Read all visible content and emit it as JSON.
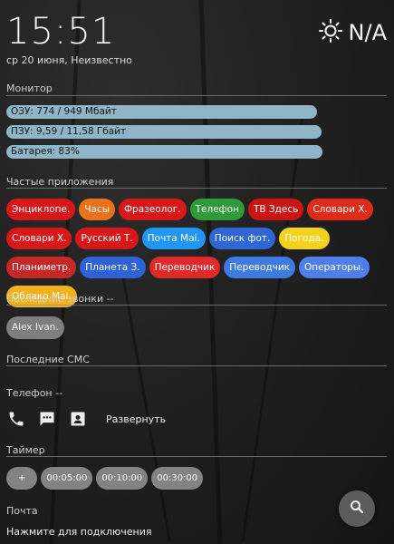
{
  "clock": {
    "time": "15:51",
    "date": "ср 20 июня, Неизвестно"
  },
  "weather": {
    "icon": "sun-icon",
    "value": "N/A"
  },
  "monitor": {
    "title": "Монитор",
    "ram": {
      "label": "ОЗУ: 774 / 949 Мбайт",
      "fill": 0.82
    },
    "storage": {
      "label": "ПЗУ: 9,59 / 11,58 Гбайт",
      "fill": 0.83
    },
    "battery": {
      "label": "Батарея: 83%",
      "fill": 0.83
    },
    "bar_color": "#8fb6c8"
  },
  "apps": {
    "title": "Частые приложения",
    "items": [
      {
        "label": "Энциклопе.",
        "color": "#d81818"
      },
      {
        "label": "Часы",
        "color": "#e8711a"
      },
      {
        "label": "Фразеолог.",
        "color": "#d81818"
      },
      {
        "label": "Телефон",
        "color": "#2e9a3a"
      },
      {
        "label": "ТВ Здесь",
        "color": "#cc1414"
      },
      {
        "label": "Словари Х.",
        "color": "#e02a1a"
      },
      {
        "label": "Словари Х.",
        "color": "#d81818"
      },
      {
        "label": "Русский Т.",
        "color": "#d81818"
      },
      {
        "label": "Почта Mai.",
        "color": "#2196f3"
      },
      {
        "label": "Поиск фот.",
        "color": "#2e66d6"
      },
      {
        "label": "Погода.",
        "color": "#f4d21c"
      },
      {
        "label": "Планиметр.",
        "color": "#c62828"
      },
      {
        "label": "Планета З.",
        "color": "#2e62d6"
      },
      {
        "label": "Переводчик",
        "color": "#e02a2a"
      },
      {
        "label": "Переводчик",
        "color": "#3d7be0"
      },
      {
        "label": "Операторы.",
        "color": "#4f7ee8"
      },
      {
        "label": "Облако Mai.",
        "color": "#f2b21c"
      }
    ]
  },
  "calls": {
    "title": "Последние звонки --",
    "contact": "Alex Ivan."
  },
  "sms": {
    "title": "Последние СМС"
  },
  "phone": {
    "title": "Телефон --",
    "icons": [
      "phone-icon",
      "message-icon",
      "contacts-icon"
    ],
    "expand_label": "Развернуть"
  },
  "timer": {
    "title": "Таймер",
    "add_label": "+",
    "presets": [
      "00:05:00",
      "00:10:00",
      "00:30:00"
    ]
  },
  "mail": {
    "title": "Почта",
    "hint": "Нажмите для подключения"
  },
  "fab": {
    "icon": "search-icon"
  }
}
